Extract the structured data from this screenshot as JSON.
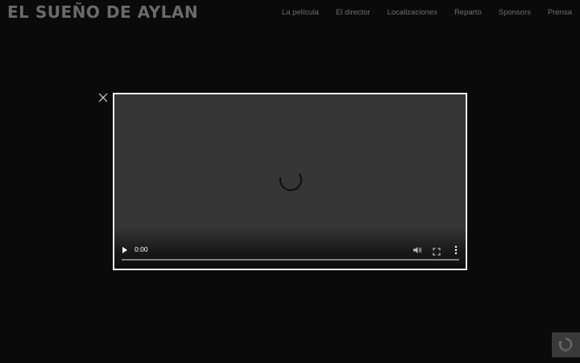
{
  "header": {
    "logo_text": "El sueño de Aylan",
    "nav": [
      {
        "label": "La película"
      },
      {
        "label": "El director"
      },
      {
        "label": "Localizaciones"
      },
      {
        "label": "Reparto"
      },
      {
        "label": "Sponsors"
      },
      {
        "label": "Prensa"
      }
    ]
  },
  "modal": {
    "close_icon": "close-icon",
    "video": {
      "time": "0:00",
      "progress": 0.0,
      "play_icon": "play-icon",
      "volume_icon": "volume-icon",
      "fullscreen_icon": "fullscreen-icon",
      "more_icon": "more-vertical-icon",
      "spinner_icon": "loading-spinner-icon"
    }
  },
  "badge": {
    "icon": "recaptcha-icon"
  },
  "colors": {
    "background": "#0a0a0a",
    "video_bg": "#363636",
    "modal_border": "#f4f4f4",
    "nav_text": "#6e6e6e",
    "logo_text": "#6a6a6a"
  }
}
